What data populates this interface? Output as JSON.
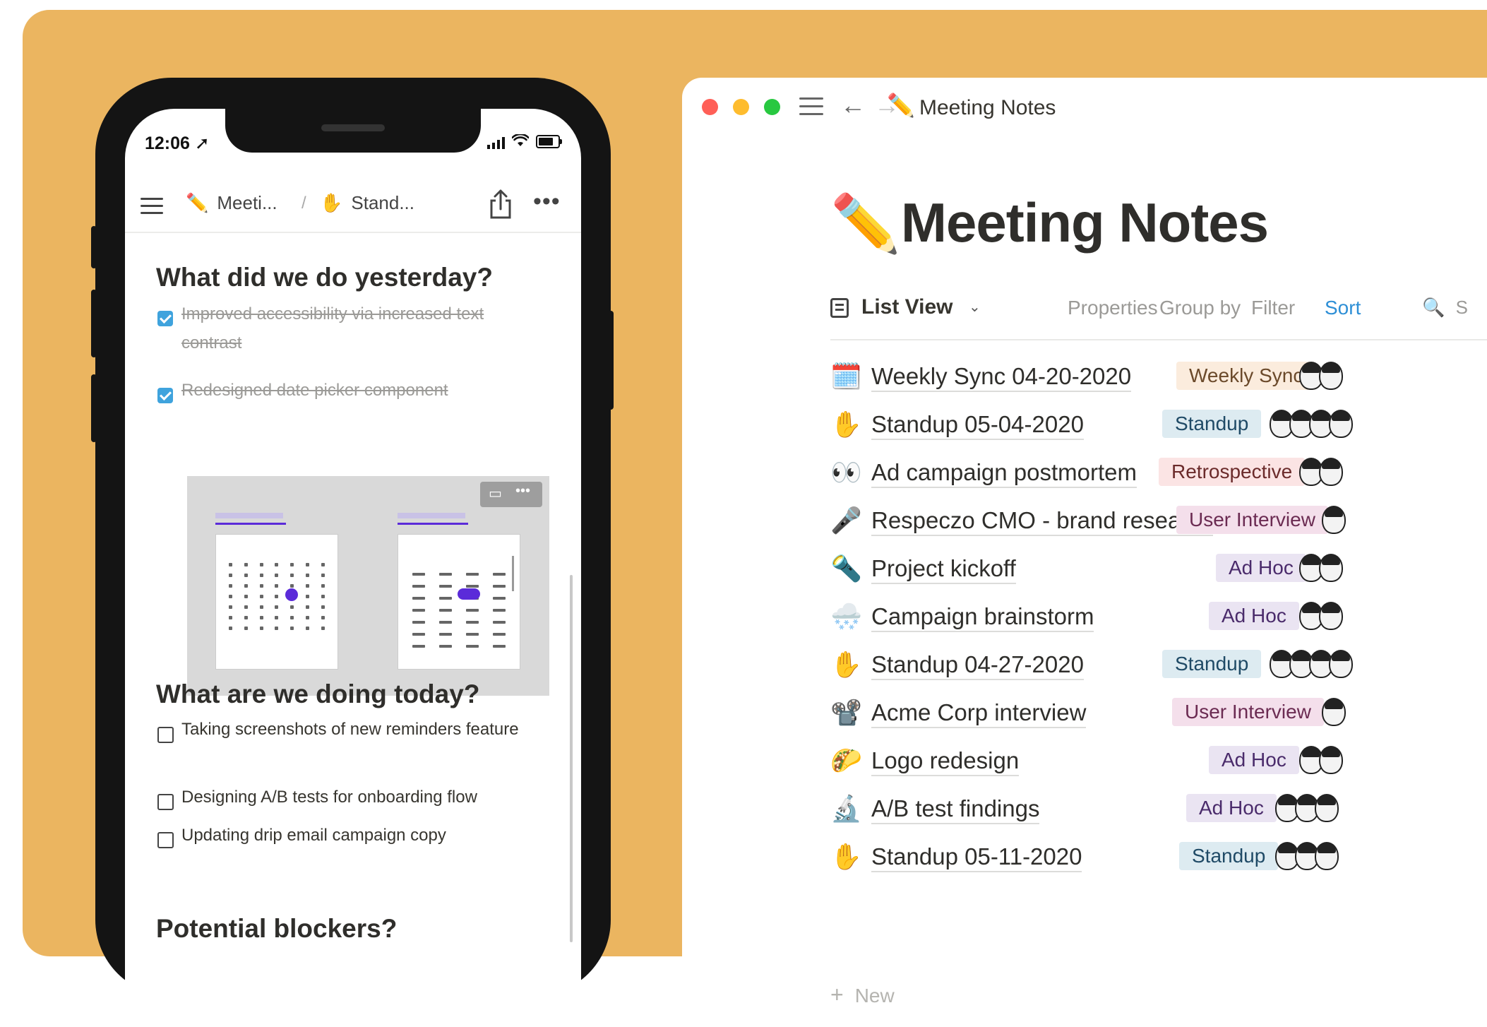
{
  "mobile": {
    "status_time": "12:06 ➚",
    "breadcrumb": [
      {
        "icon": "pencil-icon",
        "emoji": "✏️",
        "label": "Meeti..."
      },
      {
        "icon": "raised-hand-icon",
        "emoji": "✋",
        "label": "Stand..."
      }
    ],
    "breadcrumb_separator": "/",
    "sections": [
      {
        "heading": "What did we do yesterday?",
        "tasks": [
          {
            "text": "Improved accessibility via increased text contrast",
            "checked": true
          },
          {
            "text": "Redesigned date picker component",
            "checked": true
          }
        ]
      },
      {
        "heading": "What are we doing today?",
        "tasks": [
          {
            "text": "Taking screenshots of new reminders feature",
            "checked": false
          },
          {
            "text": "Designing A/B tests for onboarding flow",
            "checked": false
          },
          {
            "text": "Updating drip email campaign copy",
            "checked": false
          }
        ]
      },
      {
        "heading": "Potential blockers?",
        "tasks": []
      }
    ],
    "embed_tools": [
      "comment-icon",
      "more-icon"
    ]
  },
  "window": {
    "title": "Meeting Notes",
    "title_icon": "pencil-icon",
    "title_emoji": "✏️",
    "traffic_colors": [
      "#ff5f57",
      "#febc2e",
      "#28c840"
    ]
  },
  "page": {
    "title": "Meeting Notes",
    "title_emoji": "✏️",
    "view_label": "List View",
    "toolbar": {
      "properties": "Properties",
      "group_by": "Group by",
      "filter": "Filter",
      "sort": "Sort",
      "search_partial": "S"
    },
    "new_label": "New",
    "rows": [
      {
        "emoji": "🗓️",
        "icon": "calendar-icon",
        "title": "Weekly Sync 04-20-2020",
        "tag": "Weekly Sync",
        "tag_bg": "#fbecdd",
        "tag_fg": "#6b4a2b"
      },
      {
        "emoji": "✋",
        "icon": "raised-hand-icon",
        "title": "Standup 05-04-2020",
        "tag": "Standup",
        "tag_bg": "#ddebf1",
        "tag_fg": "#1f4a66"
      },
      {
        "emoji": "👀",
        "icon": "eyes-icon",
        "title": "Ad campaign postmortem",
        "tag": "Retrospective",
        "tag_bg": "#fbe4e4",
        "tag_fg": "#6b2b2b"
      },
      {
        "emoji": "🎤",
        "icon": "microphone-icon",
        "title": "Respeczo CMO - brand research",
        "tag": "User Interview",
        "tag_bg": "#f4dfeb",
        "tag_fg": "#6b2b52"
      },
      {
        "emoji": "🔦",
        "icon": "flashlight-icon",
        "title": "Project kickoff",
        "tag": "Ad Hoc",
        "tag_bg": "#eae4f2",
        "tag_fg": "#4a2b6b"
      },
      {
        "emoji": "🌨️",
        "icon": "snow-cloud-icon",
        "title": "Campaign brainstorm",
        "tag": "Ad Hoc",
        "tag_bg": "#eae4f2",
        "tag_fg": "#4a2b6b"
      },
      {
        "emoji": "✋",
        "icon": "raised-hand-icon",
        "title": "Standup 04-27-2020",
        "tag": "Standup",
        "tag_bg": "#ddebf1",
        "tag_fg": "#1f4a66"
      },
      {
        "emoji": "📽️",
        "icon": "projector-icon",
        "title": "Acme Corp interview",
        "tag": "User Interview",
        "tag_bg": "#f4dfeb",
        "tag_fg": "#6b2b52"
      },
      {
        "emoji": "🌮",
        "icon": "taco-icon",
        "title": "Logo redesign",
        "tag": "Ad Hoc",
        "tag_bg": "#eae4f2",
        "tag_fg": "#4a2b6b"
      },
      {
        "emoji": "🔬",
        "icon": "microscope-icon",
        "title": "A/B test findings",
        "tag": "Ad Hoc",
        "tag_bg": "#eae4f2",
        "tag_fg": "#4a2b6b"
      },
      {
        "emoji": "✋",
        "icon": "raised-hand-icon",
        "title": "Standup 05-11-2020",
        "tag": "Standup",
        "tag_bg": "#ddebf1",
        "tag_fg": "#1f4a66"
      }
    ]
  }
}
